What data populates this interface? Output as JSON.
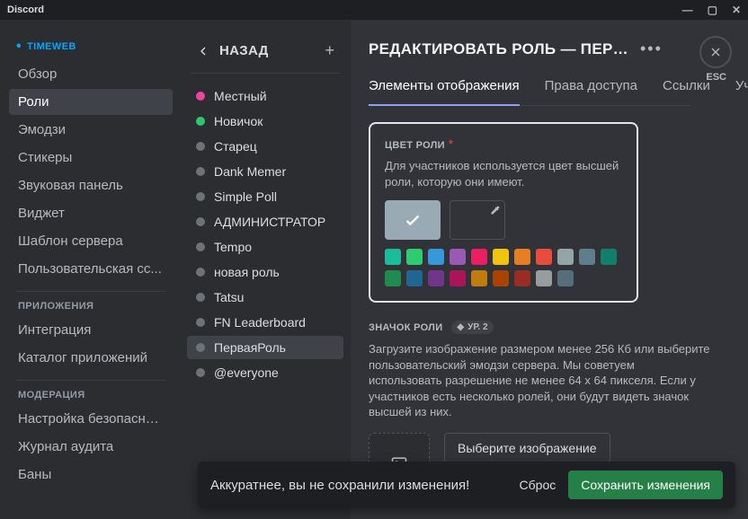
{
  "app_name": "Discord",
  "window": {
    "min": "—",
    "max": "▢",
    "close": "✕"
  },
  "server": {
    "name": "TIMEWEB"
  },
  "sidebar": {
    "items": [
      {
        "label": "Обзор"
      },
      {
        "label": "Роли",
        "active": true
      },
      {
        "label": "Эмодзи"
      },
      {
        "label": "Стикеры"
      },
      {
        "label": "Звуковая панель"
      },
      {
        "label": "Виджет"
      },
      {
        "label": "Шаблон сервера"
      },
      {
        "label": "Пользовательская сс..."
      }
    ],
    "section_apps": "ПРИЛОЖЕНИЯ",
    "apps": [
      {
        "label": "Интеграция"
      },
      {
        "label": "Каталог приложений"
      }
    ],
    "section_mod": "МОДЕРАЦИЯ",
    "mod": [
      {
        "label": "Настройка безопасно..."
      },
      {
        "label": "Журнал аудита"
      },
      {
        "label": "Баны"
      }
    ]
  },
  "roles_panel": {
    "back": "НАЗАД",
    "roles": [
      {
        "label": "Местный",
        "color": "#eb459e"
      },
      {
        "label": "Новичок",
        "color": "#2dc770"
      },
      {
        "label": "Старец",
        "color": "#6d7178"
      },
      {
        "label": "Dank Memer",
        "color": "#6d7178"
      },
      {
        "label": "Simple Poll",
        "color": "#6d7178"
      },
      {
        "label": "АДМИНИСТРАТОР",
        "color": "#6d7178"
      },
      {
        "label": "Tempo",
        "color": "#6d7178"
      },
      {
        "label": "новая роль",
        "color": "#6d7178"
      },
      {
        "label": "Tatsu",
        "color": "#6d7178"
      },
      {
        "label": "FN Leaderboard",
        "color": "#6d7178"
      },
      {
        "label": "ПерваяРоль",
        "color": "#6d7178",
        "selected": true
      },
      {
        "label": "@everyone",
        "color": "#6d7178"
      }
    ]
  },
  "editor": {
    "title": "РЕДАКТИРОВАТЬ РОЛЬ — ПЕРВАЯРО...",
    "esc": "ESC",
    "tabs": [
      {
        "label": "Элементы отображения",
        "active": true
      },
      {
        "label": "Права доступа"
      },
      {
        "label": "Ссылки"
      },
      {
        "label": "Уч"
      }
    ],
    "role_color": {
      "label": "ЦВЕТ РОЛИ",
      "required": "*",
      "desc": "Для участников используется цвет высшей роли, которую они имеют.",
      "palette_row1": [
        "#1abc9c",
        "#2ecc71",
        "#3498db",
        "#9b59b6",
        "#e91e63",
        "#f1c40f",
        "#e67e22",
        "#e74c3c",
        "#95a5a6",
        "#607d8b"
      ],
      "palette_row2": [
        "#11806a",
        "#1f8b4c",
        "#206694",
        "#71368a",
        "#ad1457",
        "#c27c0e",
        "#a84300",
        "#992d22",
        "#979c9f",
        "#546e7a"
      ]
    },
    "role_icon": {
      "label": "ЗНАЧОК РОЛИ",
      "level": "УР. 2",
      "desc": "Загрузите изображение размером менее 256 Кб или выберите пользовательский эмодзи сервера. Мы советуем использовать разрешение не менее 64 x 64 пикселя. Если у участников есть несколько ролей, они будут видеть значок высшей из них.",
      "button": "Выберите изображение"
    }
  },
  "toast": {
    "msg": "Аккуратнее, вы не сохранили изменения!",
    "reset": "Сброс",
    "save": "Сохранить изменения"
  }
}
